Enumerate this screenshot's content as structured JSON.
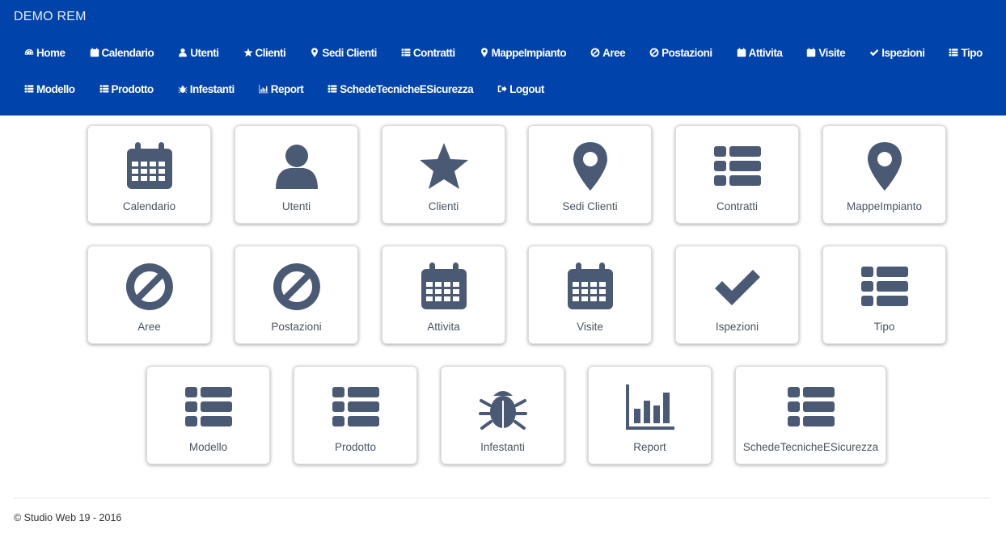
{
  "navbar": {
    "brand": "DEMO REM",
    "links_row1": [
      {
        "label": "Home",
        "icon": "dashboard-icon"
      },
      {
        "label": "Calendario",
        "icon": "calendar-icon"
      },
      {
        "label": "Utenti",
        "icon": "user-icon"
      },
      {
        "label": "Clienti",
        "icon": "star-icon"
      },
      {
        "label": "Sedi Clienti",
        "icon": "map-marker-icon"
      },
      {
        "label": "Contratti",
        "icon": "list-icon"
      },
      {
        "label": "MappeImpianto",
        "icon": "map-marker-icon"
      },
      {
        "label": "Aree",
        "icon": "ban-icon"
      },
      {
        "label": "Postazioni",
        "icon": "ban-icon"
      },
      {
        "label": "Attivita",
        "icon": "calendar-icon"
      },
      {
        "label": "Visite",
        "icon": "calendar-icon"
      },
      {
        "label": "Ispezioni",
        "icon": "check-icon"
      },
      {
        "label": "Tipo",
        "icon": "list-icon"
      }
    ],
    "links_row2": [
      {
        "label": "Modello",
        "icon": "list-icon"
      },
      {
        "label": "Prodotto",
        "icon": "list-icon"
      },
      {
        "label": "Infestanti",
        "icon": "bug-icon"
      },
      {
        "label": "Report",
        "icon": "bar-chart-icon"
      },
      {
        "label": "SchedeTecnicheESicurezza",
        "icon": "list-icon"
      },
      {
        "label": "Logout",
        "icon": "logout-icon"
      }
    ]
  },
  "tiles": [
    {
      "label": "Calendario",
      "icon": "calendar-icon"
    },
    {
      "label": "Utenti",
      "icon": "user-icon"
    },
    {
      "label": "Clienti",
      "icon": "star-icon"
    },
    {
      "label": "Sedi Clienti",
      "icon": "map-marker-icon"
    },
    {
      "label": "Contratti",
      "icon": "list-icon"
    },
    {
      "label": "MappeImpianto",
      "icon": "map-marker-icon"
    },
    {
      "label": "Aree",
      "icon": "ban-icon"
    },
    {
      "label": "Postazioni",
      "icon": "ban-icon"
    },
    {
      "label": "Attivita",
      "icon": "calendar-icon"
    },
    {
      "label": "Visite",
      "icon": "calendar-icon"
    },
    {
      "label": "Ispezioni",
      "icon": "check-icon"
    },
    {
      "label": "Tipo",
      "icon": "list-icon"
    },
    {
      "label": "Modello",
      "icon": "list-icon"
    },
    {
      "label": "Prodotto",
      "icon": "list-icon"
    },
    {
      "label": "Infestanti",
      "icon": "bug-icon"
    },
    {
      "label": "Report",
      "icon": "bar-chart-icon"
    },
    {
      "label": "SchedeTecnicheESicurezza",
      "icon": "list-icon"
    }
  ],
  "footer": {
    "text": "© Studio Web 19 - 2016"
  },
  "colors": {
    "navbar": "#0043ab",
    "icon": "#4a5a75",
    "tile_label": "#4a5461"
  }
}
